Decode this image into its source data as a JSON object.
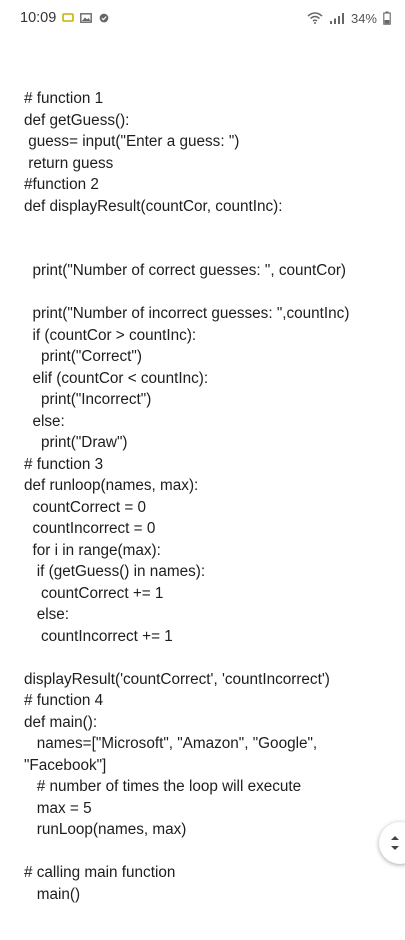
{
  "status_bar": {
    "time": "10:09",
    "icons": [
      "chat-notification-icon",
      "image-notification-icon",
      "no-disturb-icon"
    ],
    "right_icons": [
      "wifi-icon",
      "signal-icon"
    ],
    "battery": "34%"
  },
  "code_lines": [
    "# function 1",
    "def getGuess():",
    " guess= input(\"Enter a guess: \")",
    " return guess",
    "#function 2",
    "def displayResult(countCor, countInc):",
    "",
    "",
    "  print(\"Number of correct guesses: \", countCor)",
    "",
    "  print(\"Number of incorrect guesses: \",countInc)",
    "  if (countCor > countInc):",
    "    print(\"Correct\")",
    "  elif (countCor < countInc):",
    "    print(\"Incorrect\")",
    "  else:",
    "    print(\"Draw\")",
    "# function 3",
    "def runloop(names, max):",
    "  countCorrect = 0",
    "  countIncorrect = 0",
    "  for i in range(max):",
    "   if (getGuess() in names):",
    "    countCorrect += 1",
    "   else:",
    "    countIncorrect += 1",
    "",
    "displayResult('countCorrect', 'countIncorrect')",
    "# function 4",
    "def main():",
    "   names=[\"Microsoft\", \"Amazon\", \"Google\",",
    "\"Facebook\"]",
    "   # number of times the loop will execute",
    "   max = 5",
    "   runLoop(names, max)",
    "",
    "# calling main function",
    "   main()"
  ]
}
